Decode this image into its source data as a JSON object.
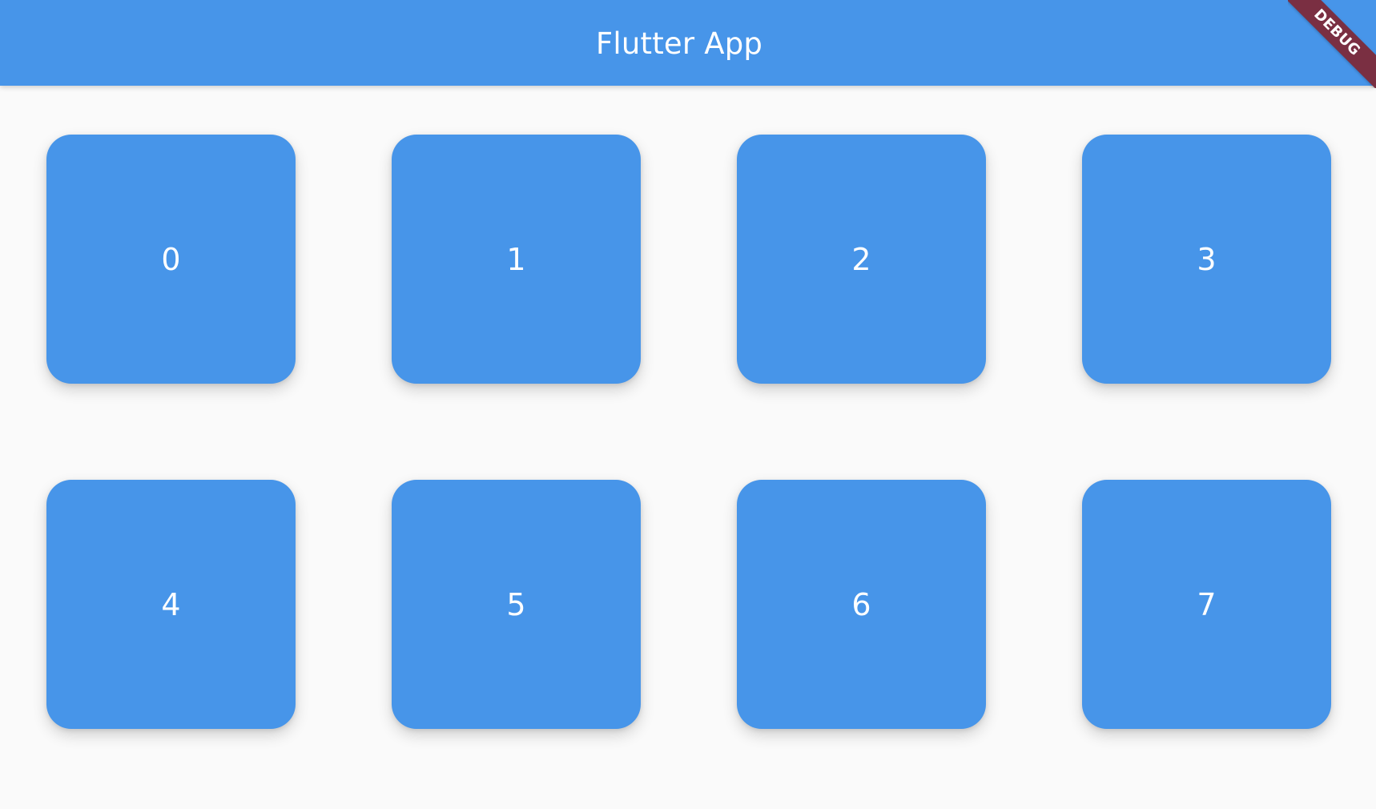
{
  "app_bar": {
    "title": "Flutter App",
    "background_color": "#4795E9",
    "title_color": "#FFFFFF"
  },
  "debug_banner": {
    "label": "DEBUG",
    "color": "#7A2F42"
  },
  "grid": {
    "tile_color": "#4795E9",
    "tiles": [
      {
        "label": "0"
      },
      {
        "label": "1"
      },
      {
        "label": "2"
      },
      {
        "label": "3"
      },
      {
        "label": "4"
      },
      {
        "label": "5"
      },
      {
        "label": "6"
      },
      {
        "label": "7"
      }
    ]
  }
}
